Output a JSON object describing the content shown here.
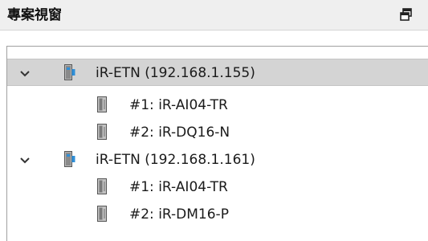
{
  "panel": {
    "title": "專案視窗",
    "float_icon": "float-window-icon"
  },
  "tree": {
    "nodes": [
      {
        "label": "iR-ETN (192.168.1.155)",
        "expanded": true,
        "selected": true,
        "icon": "network-adapter-icon",
        "children": [
          {
            "label": "#1: iR-AI04-TR",
            "icon": "io-module-icon"
          },
          {
            "label": "#2: iR-DQ16-N",
            "icon": "io-module-icon"
          }
        ]
      },
      {
        "label": "iR-ETN (192.168.1.161)",
        "expanded": true,
        "selected": false,
        "icon": "network-adapter-icon",
        "children": [
          {
            "label": "#1: iR-AI04-TR",
            "icon": "io-module-icon"
          },
          {
            "label": "#2: iR-DM16-P",
            "icon": "io-module-icon"
          }
        ]
      }
    ]
  },
  "colors": {
    "header_bg": "#efefef",
    "selection_bg": "#d4d4d4",
    "adapter_accent": "#2f8fd8"
  }
}
